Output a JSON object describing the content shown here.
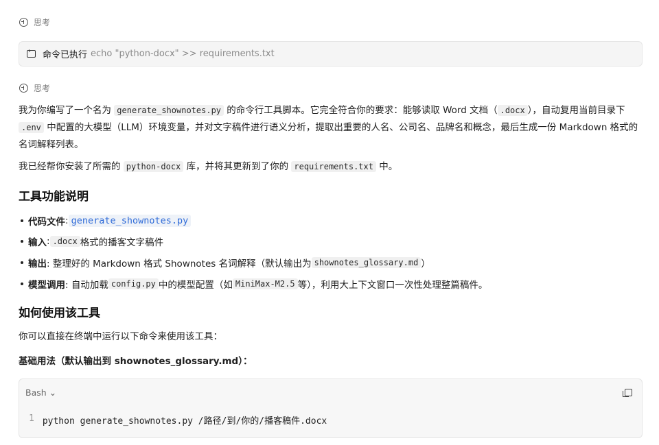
{
  "thinking_label": "思考",
  "command": {
    "label": "命令已执行",
    "text": "echo \"python-docx\" >> requirements.txt"
  },
  "intro": {
    "p1_a": "我为你编写了一个名为 ",
    "p1_code1": "generate_shownotes.py",
    "p1_b": " 的命令行工具脚本。它完全符合你的要求：能够读取 Word 文档（",
    "p1_code2": ".docx",
    "p1_c": "），自动复用当前目录下 ",
    "p1_code3": ".env",
    "p1_d": " 中配置的大模型（LLM）环境变量，并对文字稿件进行语义分析，提取出重要的人名、公司名、品牌名和概念，最后生成一份 Markdown 格式的名词解释列表。",
    "p2_a": "我已经帮你安装了所需的 ",
    "p2_code1": "python-docx",
    "p2_b": " 库，并将其更新到了你的 ",
    "p2_code2": "requirements.txt",
    "p2_c": " 中。"
  },
  "section1": {
    "title": "工具功能说明",
    "items": [
      {
        "label": "代码文件",
        "sep": ": ",
        "code": "generate_shownotes.py",
        "rest": ""
      },
      {
        "label": "输入",
        "sep": ": ",
        "code": ".docx",
        "rest": " 格式的播客文字稿件"
      },
      {
        "label": "输出",
        "sep": ": 整理好的 Markdown 格式 Shownotes 名词解释（默认输出为 ",
        "code": "shownotes_glossary.md",
        "rest": "）"
      },
      {
        "label": "模型调用",
        "sep": ": 自动加载 ",
        "code": "config.py",
        "rest": " 中的模型配置（如 ",
        "code2": "MiniMax-M2.5",
        "rest2": " 等），利用大上下文窗口一次性处理整篇稿件。"
      }
    ]
  },
  "section2": {
    "title": "如何使用该工具",
    "p": "你可以直接在终端中运行以下命令来使用该工具：",
    "basic_usage": "基础用法（默认输出到 shownotes_glossary.md）："
  },
  "code_block": {
    "language": "Bash",
    "lang_chevron": "⌄",
    "line_number": "1",
    "line": "python generate_shownotes.py /路径/到/你的/播客稿件.docx"
  }
}
